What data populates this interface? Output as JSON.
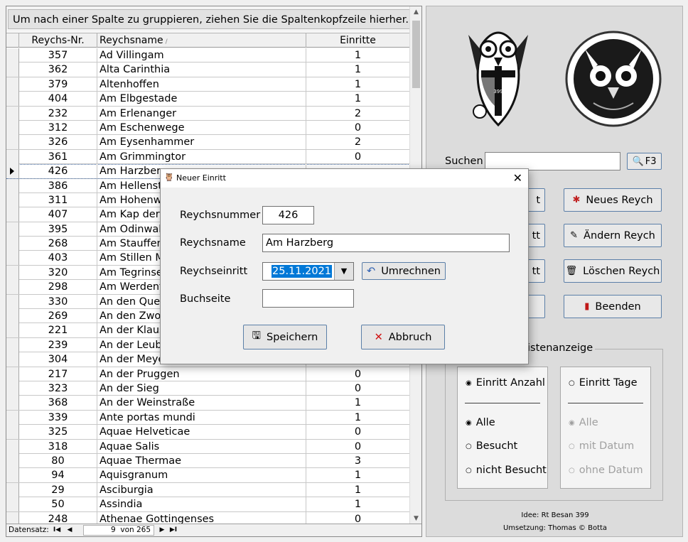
{
  "grid": {
    "group_hint": "Um nach einer Spalte zu gruppieren, ziehen Sie die Spaltenkopfzeile hierher.",
    "columns": {
      "nr": "Reychs-Nr.",
      "name": "Reychsname",
      "einritte": "Einritte"
    },
    "current_row": 8,
    "rows": [
      {
        "nr": "357",
        "name": "Ad Villingam",
        "einritte": "1"
      },
      {
        "nr": "362",
        "name": "Alta Carinthia",
        "einritte": "1"
      },
      {
        "nr": "379",
        "name": "Altenhoffen",
        "einritte": "1"
      },
      {
        "nr": "404",
        "name": "Am Elbgestade",
        "einritte": "1"
      },
      {
        "nr": "232",
        "name": "Am Erlenanger",
        "einritte": "2"
      },
      {
        "nr": "312",
        "name": "Am Eschenwege",
        "einritte": "0"
      },
      {
        "nr": "326",
        "name": "Am Eysenhammer",
        "einritte": "2"
      },
      {
        "nr": "361",
        "name": "Am Grimmingtor",
        "einritte": "0"
      },
      {
        "nr": "426",
        "name": "Am Harzberg",
        "einritte": ""
      },
      {
        "nr": "386",
        "name": "Am Hellenste",
        "einritte": ""
      },
      {
        "nr": "311",
        "name": "Am Hohenwa",
        "einritte": ""
      },
      {
        "nr": "407",
        "name": "Am Kap der (",
        "einritte": ""
      },
      {
        "nr": "395",
        "name": "Am Odinwald",
        "einritte": ""
      },
      {
        "nr": "268",
        "name": "Am Stauffen",
        "einritte": ""
      },
      {
        "nr": "403",
        "name": "Am Stillen M",
        "einritte": ""
      },
      {
        "nr": "320",
        "name": "Am Tegrinse",
        "einritte": ""
      },
      {
        "nr": "298",
        "name": "Am Werdenfe",
        "einritte": ""
      },
      {
        "nr": "330",
        "name": "An den Quell",
        "einritte": ""
      },
      {
        "nr": "269",
        "name": "An den Zwo I",
        "einritte": ""
      },
      {
        "nr": "221",
        "name": "An der Klaus",
        "einritte": ""
      },
      {
        "nr": "239",
        "name": "An der Leube",
        "einritte": ""
      },
      {
        "nr": "304",
        "name": "An der Meyer",
        "einritte": ""
      },
      {
        "nr": "217",
        "name": "An der Pruggen",
        "einritte": "0"
      },
      {
        "nr": "323",
        "name": "An der Sieg",
        "einritte": "0"
      },
      {
        "nr": "368",
        "name": "An der Weinstraße",
        "einritte": "1"
      },
      {
        "nr": "339",
        "name": "Ante portas mundi",
        "einritte": "1"
      },
      {
        "nr": "325",
        "name": "Aquae Helveticae",
        "einritte": "0"
      },
      {
        "nr": "318",
        "name": "Aquae Salis",
        "einritte": "0"
      },
      {
        "nr": "80",
        "name": "Aquae Thermae",
        "einritte": "3"
      },
      {
        "nr": "94",
        "name": "Aquisgranum",
        "einritte": "1"
      },
      {
        "nr": "29",
        "name": "Asciburgia",
        "einritte": "1"
      },
      {
        "nr": "50",
        "name": "Assindia",
        "einritte": "1"
      },
      {
        "nr": "248",
        "name": "Athenae Gottingenses",
        "einritte": "0"
      }
    ],
    "navigator": {
      "label": "Datensatz:",
      "position": "9",
      "of_label": "von 265"
    }
  },
  "panel": {
    "search_label": "Suchen",
    "search_value": "",
    "f3_label": "F3",
    "buttons": {
      "neues_reych": "Neues Reych",
      "aendern_reych": "Ändern Reych",
      "loeschen_reych": "Löschen Reych",
      "beenden": "Beenden",
      "ghost1": "t",
      "ghost2": "tt",
      "ghost3": "tt"
    },
    "listen_title": "istenanzeige",
    "options": {
      "einritt_anzahl": "Einritt Anzahl",
      "einritt_tage": "Einritt Tage",
      "alle": "Alle",
      "besucht": "Besucht",
      "nicht_besucht": "nicht Besucht",
      "alle2": "Alle",
      "mit_datum": "mit Datum",
      "ohne_datum": "ohne Datum"
    },
    "credits": {
      "idee": "Idee: Rt Besan 399",
      "umsetzung": "Umsetzung: Thomas © Botta"
    },
    "shield_number": "399"
  },
  "dialog": {
    "title": "Neuer Einritt",
    "labels": {
      "nummer": "Reychsnummer",
      "name": "Reychsname",
      "einritt": "Reychseinritt",
      "buchseite": "Buchseite"
    },
    "values": {
      "nummer": "426",
      "name": "Am Harzberg",
      "einritt": "25.11.2021",
      "buchseite": ""
    },
    "buttons": {
      "umrechnen": "Umrechnen",
      "speichern": "Speichern",
      "abbruch": "Abbruch"
    }
  },
  "colors": {
    "selection": "#0078d7",
    "button_border": "#5b7fa8",
    "panel_bg": "#dcdcdc",
    "abbruch_icon": "#d01010",
    "neues_icon": "#c02020"
  }
}
